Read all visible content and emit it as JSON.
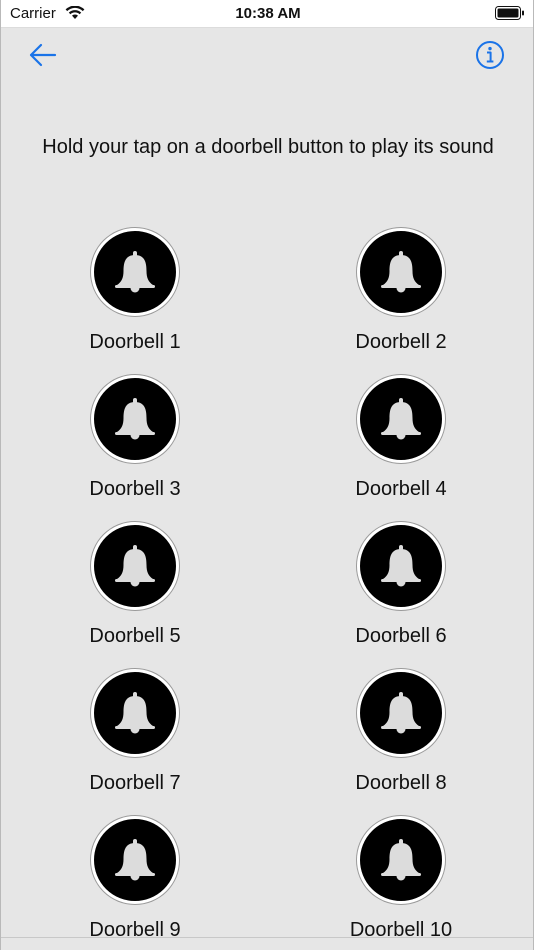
{
  "status_bar": {
    "carrier": "Carrier",
    "time": "10:38 AM"
  },
  "nav": {
    "back_icon": "arrow-left-icon",
    "info_icon": "info-circle-icon",
    "accent_color": "#1a73e8"
  },
  "instruction": "Hold your tap on a doorbell button to play its sound",
  "doorbells": [
    {
      "label": "Doorbell 1",
      "icon": "bell-icon"
    },
    {
      "label": "Doorbell 2",
      "icon": "bell-icon"
    },
    {
      "label": "Doorbell 3",
      "icon": "bell-icon"
    },
    {
      "label": "Doorbell 4",
      "icon": "bell-icon"
    },
    {
      "label": "Doorbell 5",
      "icon": "bell-icon"
    },
    {
      "label": "Doorbell 6",
      "icon": "bell-icon"
    },
    {
      "label": "Doorbell 7",
      "icon": "bell-icon"
    },
    {
      "label": "Doorbell 8",
      "icon": "bell-icon"
    },
    {
      "label": "Doorbell 9",
      "icon": "bell-icon"
    },
    {
      "label": "Doorbell 10",
      "icon": "bell-icon"
    }
  ]
}
